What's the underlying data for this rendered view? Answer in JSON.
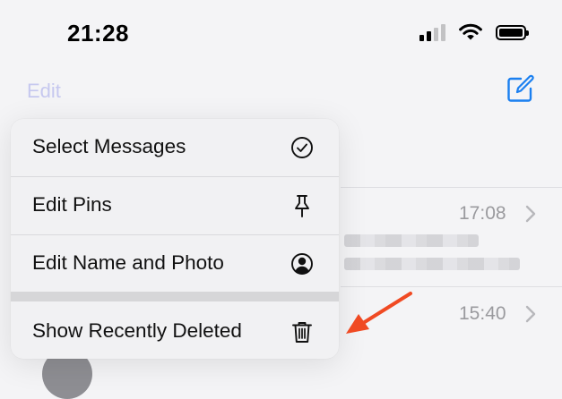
{
  "status": {
    "time": "21:28"
  },
  "nav": {
    "edit_label": "Edit"
  },
  "rows": [
    {
      "time": "17:08"
    },
    {
      "time": "15:40"
    }
  ],
  "menu": {
    "items": [
      {
        "label": "Select Messages",
        "icon": "checkmark-circle-icon"
      },
      {
        "label": "Edit Pins",
        "icon": "pin-icon"
      },
      {
        "label": "Edit Name and Photo",
        "icon": "person-circle-icon"
      },
      {
        "label": "Show Recently Deleted",
        "icon": "trash-icon"
      }
    ]
  },
  "colors": {
    "accent": "#1a7ff0",
    "edit_dimmed": "#c6c8ef",
    "annotation_arrow": "#f04a23"
  }
}
